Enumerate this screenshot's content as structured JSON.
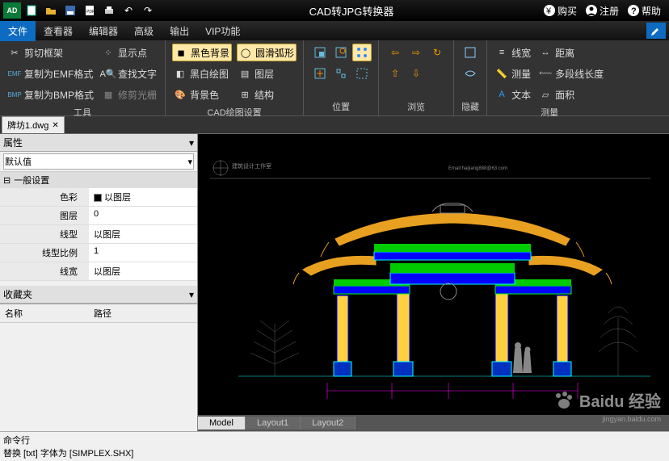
{
  "title": "CAD转JPG转换器",
  "title_right": {
    "buy": "购买",
    "register": "注册",
    "help": "帮助"
  },
  "menu": {
    "file": "文件",
    "viewer": "查看器",
    "editor": "编辑器",
    "advanced": "高级",
    "output": "输出",
    "vip": "VIP功能"
  },
  "ribbon": {
    "tools": {
      "label": "工具",
      "clip_frame": "剪切框架",
      "copy_emf": "复制为EMF格式",
      "copy_bmp": "复制为BMP格式",
      "show_points": "显示点",
      "find_text": "查找文字",
      "trim_raster": "修剪光栅"
    },
    "cad_settings": {
      "label": "CAD绘图设置",
      "black_bg": "黑色背景",
      "bw_draw": "黑白绘图",
      "bg_color": "背景色",
      "smooth_arc": "圆滑弧形",
      "layers": "图层",
      "structure": "结构"
    },
    "position": {
      "label": "位置"
    },
    "browse": {
      "label": "浏览"
    },
    "hide": {
      "label": "隐藏"
    },
    "measure": {
      "label": "测量",
      "linewidth": "线宽",
      "measure": "测量",
      "text": "文本",
      "distance": "距离",
      "polyline_len": "多段线长度",
      "area": "面积"
    }
  },
  "doc_tab": "牌坊1.dwg",
  "panel": {
    "properties": "属性",
    "default": "默认值",
    "general": "一般设置",
    "rows": {
      "color": {
        "label": "色彩",
        "value": "以图层"
      },
      "layer": {
        "label": "图层",
        "value": "0"
      },
      "linetype": {
        "label": "线型",
        "value": "以图层"
      },
      "scale": {
        "label": "线型比例",
        "value": "1"
      },
      "lineweight": {
        "label": "线宽",
        "value": "以图层"
      }
    },
    "favorites": "收藏夹",
    "fav_cols": {
      "name": "名称",
      "path": "路径"
    }
  },
  "layout_tabs": {
    "model": "Model",
    "layout1": "Layout1",
    "layout2": "Layout2"
  },
  "watermark": "Baidu 经验",
  "watermark_sub": "jingyan.baidu.com",
  "cmd": {
    "line1": "命令行",
    "line2": "替换 [txt] 字体为 [SIMPLEX.SHX]"
  },
  "drawing_text": {
    "studio": "建筑设计工作室",
    "email": "Email:haijiang888@63.com"
  }
}
